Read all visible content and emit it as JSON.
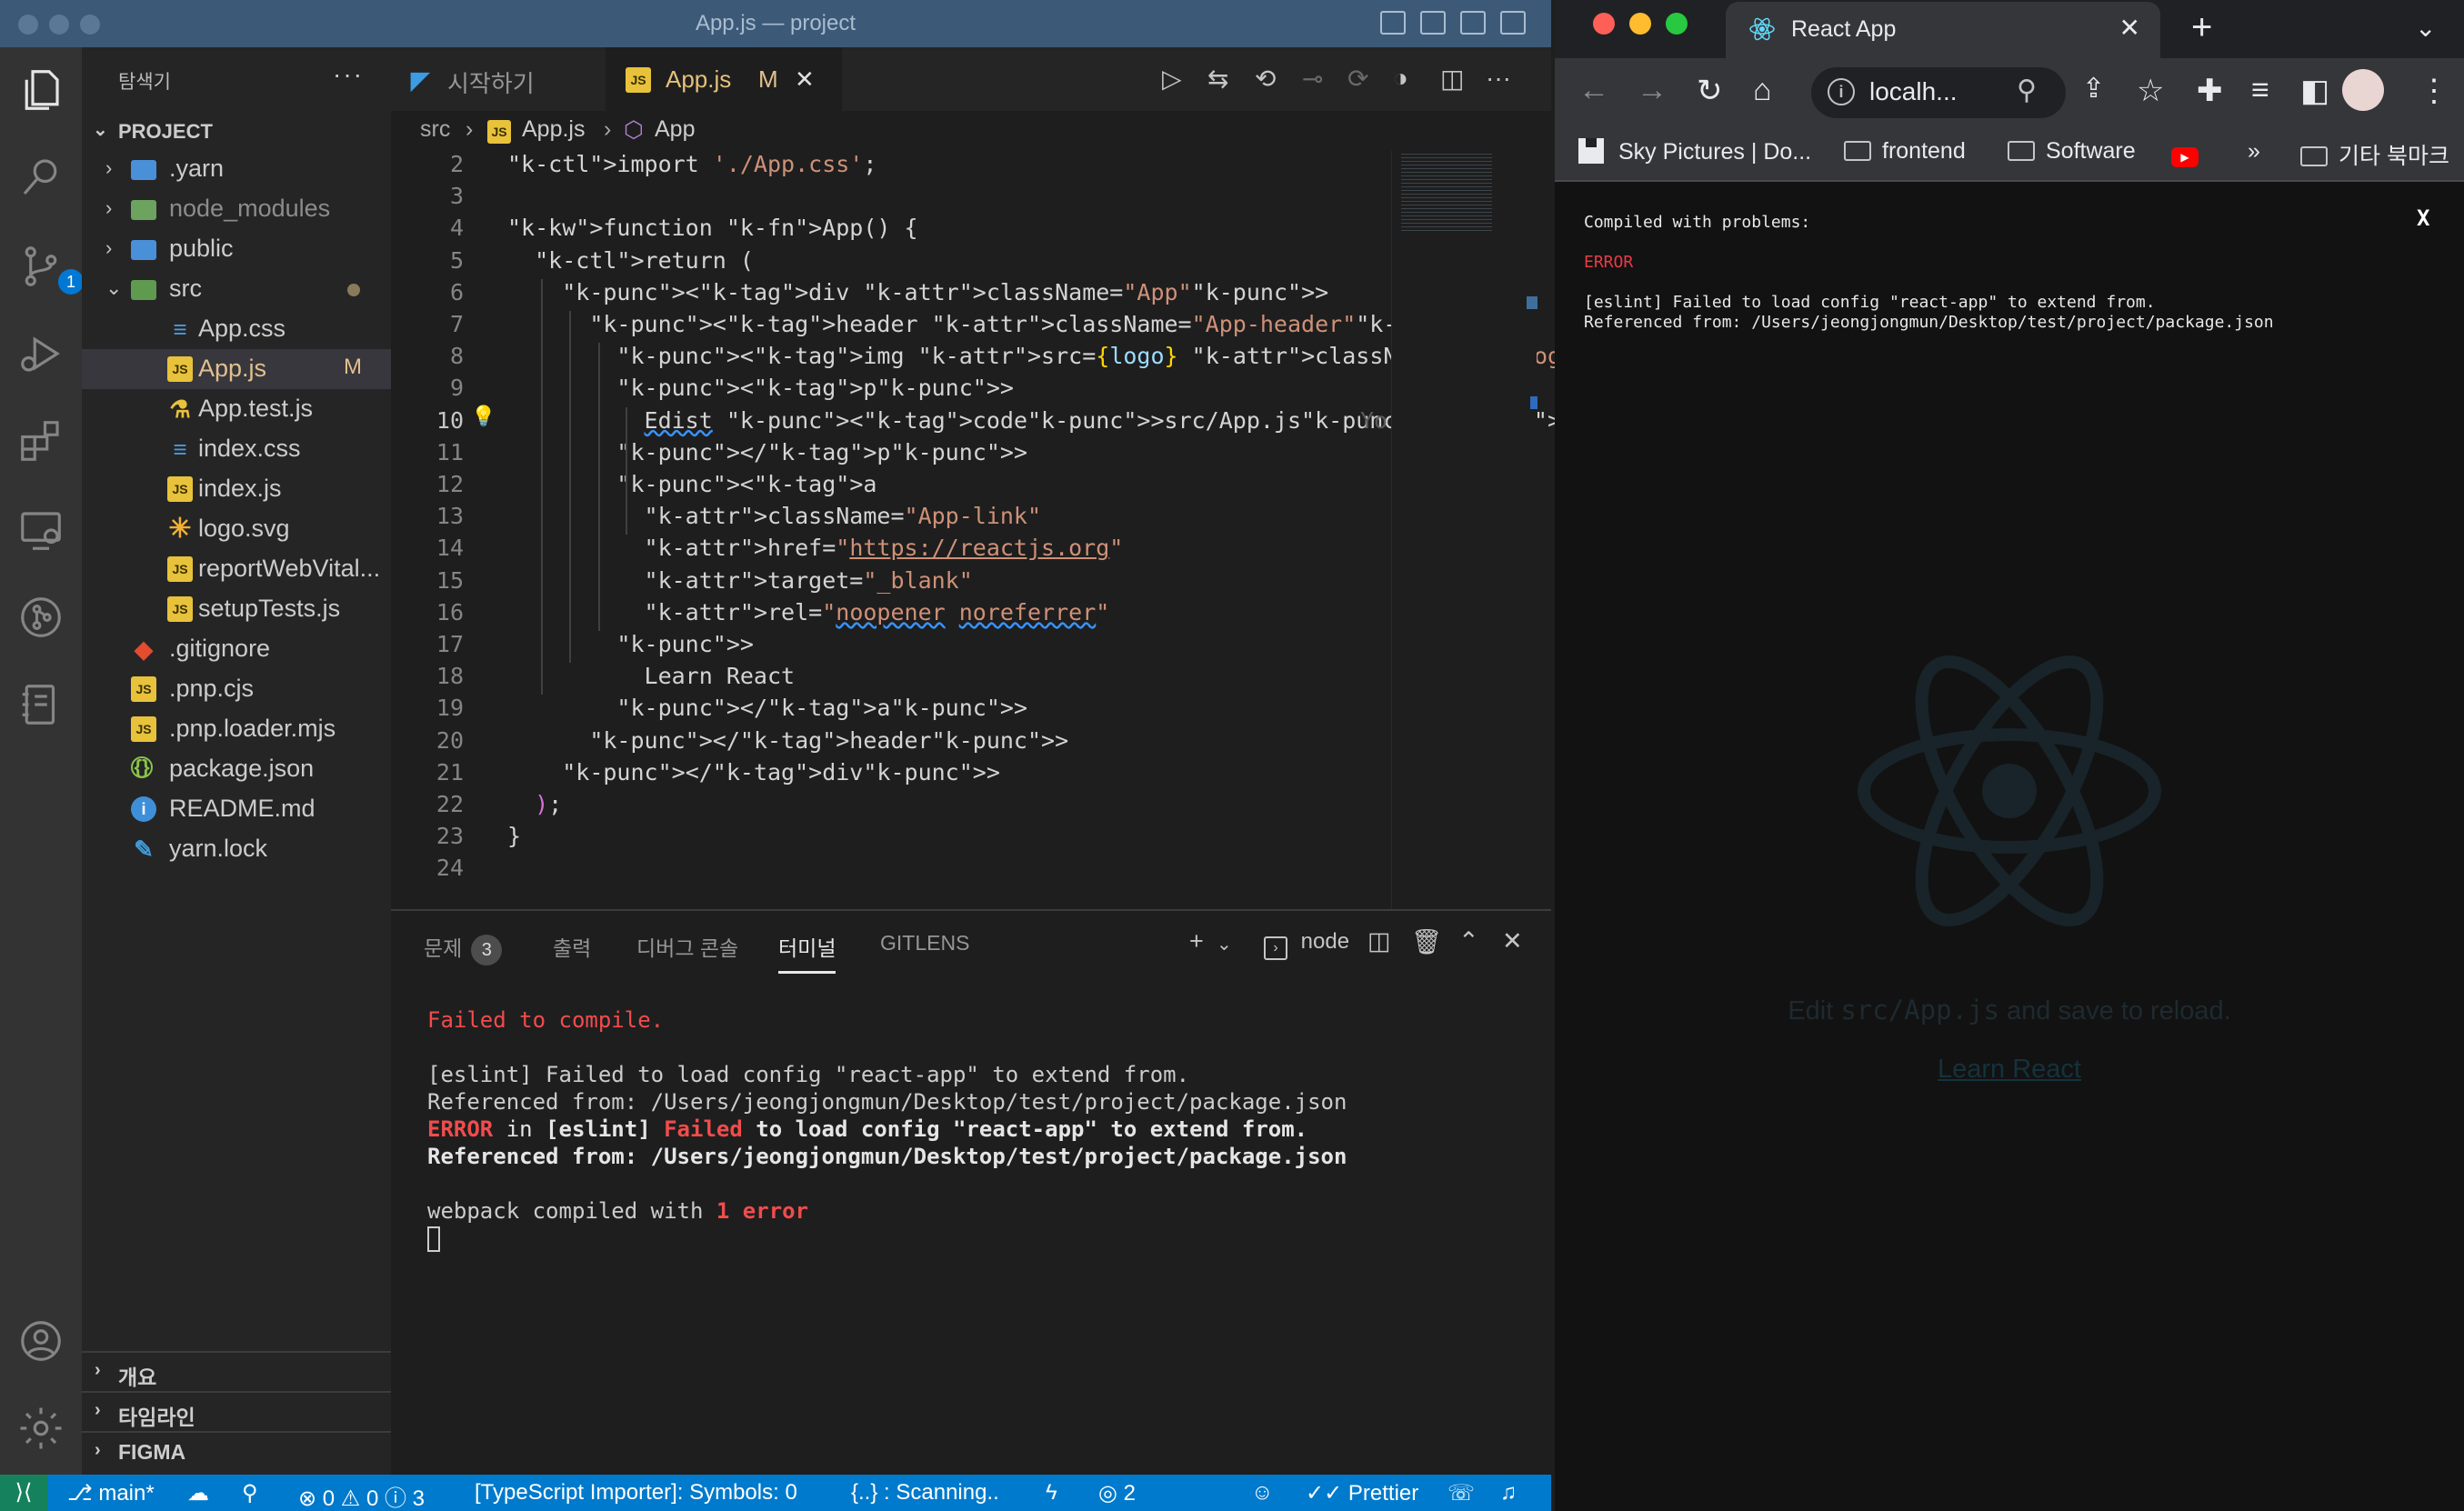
{
  "vscode": {
    "window_title": "App.js — project",
    "sidebar": {
      "header": "탐색기",
      "more": "···",
      "project": "PROJECT",
      "tree": [
        {
          "name": ".yarn",
          "kind": "folder",
          "depth": 1,
          "expanded": false
        },
        {
          "name": "node_modules",
          "kind": "folder",
          "depth": 1,
          "expanded": false
        },
        {
          "name": "public",
          "kind": "folder",
          "depth": 1,
          "expanded": false
        },
        {
          "name": "src",
          "kind": "folder",
          "depth": 1,
          "expanded": true
        },
        {
          "name": "App.css",
          "kind": "css",
          "depth": 2
        },
        {
          "name": "App.js",
          "kind": "js",
          "depth": 2,
          "modified": "M",
          "selected": true
        },
        {
          "name": "App.test.js",
          "kind": "test",
          "depth": 2
        },
        {
          "name": "index.css",
          "kind": "css",
          "depth": 2
        },
        {
          "name": "index.js",
          "kind": "js",
          "depth": 2
        },
        {
          "name": "logo.svg",
          "kind": "svg",
          "depth": 2
        },
        {
          "name": "reportWebVital...",
          "kind": "js",
          "depth": 2
        },
        {
          "name": "setupTests.js",
          "kind": "js",
          "depth": 2
        },
        {
          "name": ".gitignore",
          "kind": "git",
          "depth": 1
        },
        {
          "name": ".pnp.cjs",
          "kind": "js",
          "depth": 1
        },
        {
          "name": ".pnp.loader.mjs",
          "kind": "js",
          "depth": 1
        },
        {
          "name": "package.json",
          "kind": "json",
          "depth": 1
        },
        {
          "name": "README.md",
          "kind": "info",
          "depth": 1
        },
        {
          "name": "yarn.lock",
          "kind": "yarn",
          "depth": 1
        }
      ],
      "sections": [
        "개요",
        "타임라인",
        "FIGMA"
      ]
    },
    "tabs": [
      {
        "label": "시작하기",
        "active": false
      },
      {
        "label": "App.js",
        "active": true,
        "modified": "M"
      }
    ],
    "breadcrumb": [
      "src",
      "App.js",
      "App"
    ],
    "code_lines": [
      {
        "n": "2",
        "text": "import './App.css';"
      },
      {
        "n": "3",
        "text": ""
      },
      {
        "n": "4",
        "text": "function App() {"
      },
      {
        "n": "5",
        "text": "  return ("
      },
      {
        "n": "6",
        "text": "    <div className=\"App\">"
      },
      {
        "n": "7",
        "text": "      <header className=\"App-header\">"
      },
      {
        "n": "8",
        "text": "        <img src={logo} className=\"App-logo\" alt=\"logo\" />"
      },
      {
        "n": "9",
        "text": "        <p>"
      },
      {
        "n": "10",
        "text": "          Edist <code>src/App.js</code> and save to reload."
      },
      {
        "n": "11",
        "text": "        </p>"
      },
      {
        "n": "12",
        "text": "        <a"
      },
      {
        "n": "13",
        "text": "          className=\"App-link\""
      },
      {
        "n": "14",
        "text": "          href=\"https://reactjs.org\""
      },
      {
        "n": "15",
        "text": "          target=\"_blank\""
      },
      {
        "n": "16",
        "text": "          rel=\"noopener noreferrer\""
      },
      {
        "n": "17",
        "text": "        >"
      },
      {
        "n": "18",
        "text": "          Learn React"
      },
      {
        "n": "19",
        "text": "        </a>"
      },
      {
        "n": "20",
        "text": "      </header>"
      },
      {
        "n": "21",
        "text": "    </div>"
      },
      {
        "n": "22",
        "text": "  );"
      },
      {
        "n": "23",
        "text": "}"
      },
      {
        "n": "24",
        "text": ""
      }
    ],
    "ghost_text": "Yo",
    "panel": {
      "tabs": [
        {
          "label": "문제",
          "badge": "3"
        },
        {
          "label": "출력"
        },
        {
          "label": "디버그 콘솔"
        },
        {
          "label": "터미널",
          "active": true
        },
        {
          "label": "GITLENS"
        }
      ],
      "shell": "node",
      "terminal": {
        "line1": "Failed to compile.",
        "line2": "[eslint] Failed to load config \"react-app\" to extend from.",
        "line3": "Referenced from: /Users/jeongjongmun/Desktop/test/project/package.json",
        "line4_a": "ERROR",
        "line4_b": " in ",
        "line4_c": "[eslint] ",
        "line4_d": "Failed",
        "line4_e": " to load config \"react-app\" to extend from.",
        "line5": "Referenced from: /Users/jeongjongmun/Desktop/test/project/package.json",
        "line6_a": "webpack compiled with ",
        "line6_b": "1 error"
      }
    },
    "status": {
      "branch": "main*",
      "problems": "⊗ 0  ⚠ 0  ⓘ 3",
      "ts_importer": "[TypeScript Importer]: Symbols: 0",
      "scanning": "{..} : Scanning..",
      "ports": "2",
      "prettier": "✓✓ Prettier"
    }
  },
  "chrome": {
    "tab_title": "React App",
    "url": "localh...",
    "bookmarks": [
      "Sky Pictures | Do...",
      "frontend",
      "Software",
      "»",
      "기타 북마크"
    ],
    "overlay": {
      "title": "Compiled with problems:",
      "close": "X",
      "error_label": "ERROR",
      "message_line1": "[eslint] Failed to load config \"react-app\" to extend from.",
      "message_line2": "Referenced from: /Users/jeongjongmun/Desktop/test/project/package.json"
    },
    "background_text_prefix": "Edit ",
    "background_text_code": "src/App.js",
    "background_text_suffix": " and save to reload.",
    "background_link": "Learn React"
  }
}
